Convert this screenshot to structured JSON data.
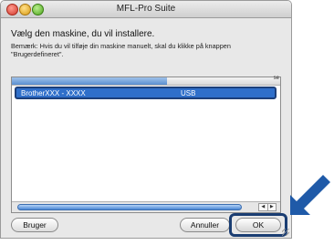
{
  "window": {
    "title": "MFL-Pro Suite"
  },
  "content": {
    "heading": "Vælg den maskine, du vil installere.",
    "note_line1": "Bemærk: Hvis du vil tilføje din maskine manuelt, skal du klikke på knappen",
    "note_line2": "\"Brugerdefineret\"."
  },
  "list": {
    "header_right_fragment": "se",
    "selected_row": {
      "name": "BrotherXXX - XXXX",
      "type": "USB"
    }
  },
  "buttons": {
    "bruger": "Bruger",
    "annuller": "Annuller",
    "ok": "OK"
  },
  "colors": {
    "selection": "#2f6fca",
    "highlight_arrow": "#1f5aa8"
  },
  "icons": {
    "pointer": "arrow-pointer-icon"
  }
}
